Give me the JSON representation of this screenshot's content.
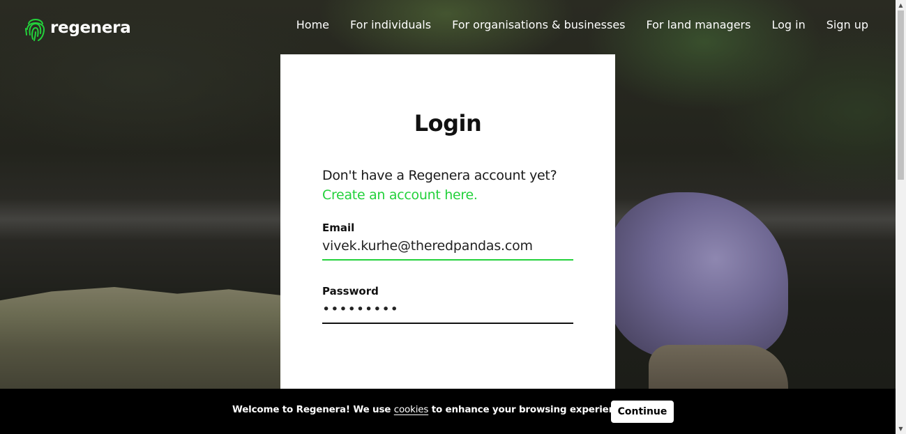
{
  "header": {
    "brand": "regenera",
    "nav": [
      {
        "label": "Home"
      },
      {
        "label": "For individuals"
      },
      {
        "label": "For organisations & businesses"
      },
      {
        "label": "For land managers"
      },
      {
        "label": "Log in"
      },
      {
        "label": "Sign up"
      }
    ]
  },
  "login": {
    "title": "Login",
    "prompt": "Don't have a Regenera account yet?",
    "create_link": "Create an account here.",
    "email": {
      "label": "Email",
      "value": "vivek.kurhe@theredpandas.com"
    },
    "password": {
      "label": "Password",
      "value": "•••••••••"
    }
  },
  "cookie_banner": {
    "text_before": "Welcome to Regenera! We use ",
    "link": "cookies",
    "text_after": " to enhance your browsing experience.",
    "button": "Continue"
  },
  "colors": {
    "accent_green": "#23d13b",
    "banner_bg": "#000000",
    "card_bg": "#ffffff"
  },
  "icons": {
    "logo": "fingerprint-logo-icon",
    "scroll_up": "scroll-up-arrow-icon",
    "scroll_down": "scroll-down-arrow-icon"
  }
}
